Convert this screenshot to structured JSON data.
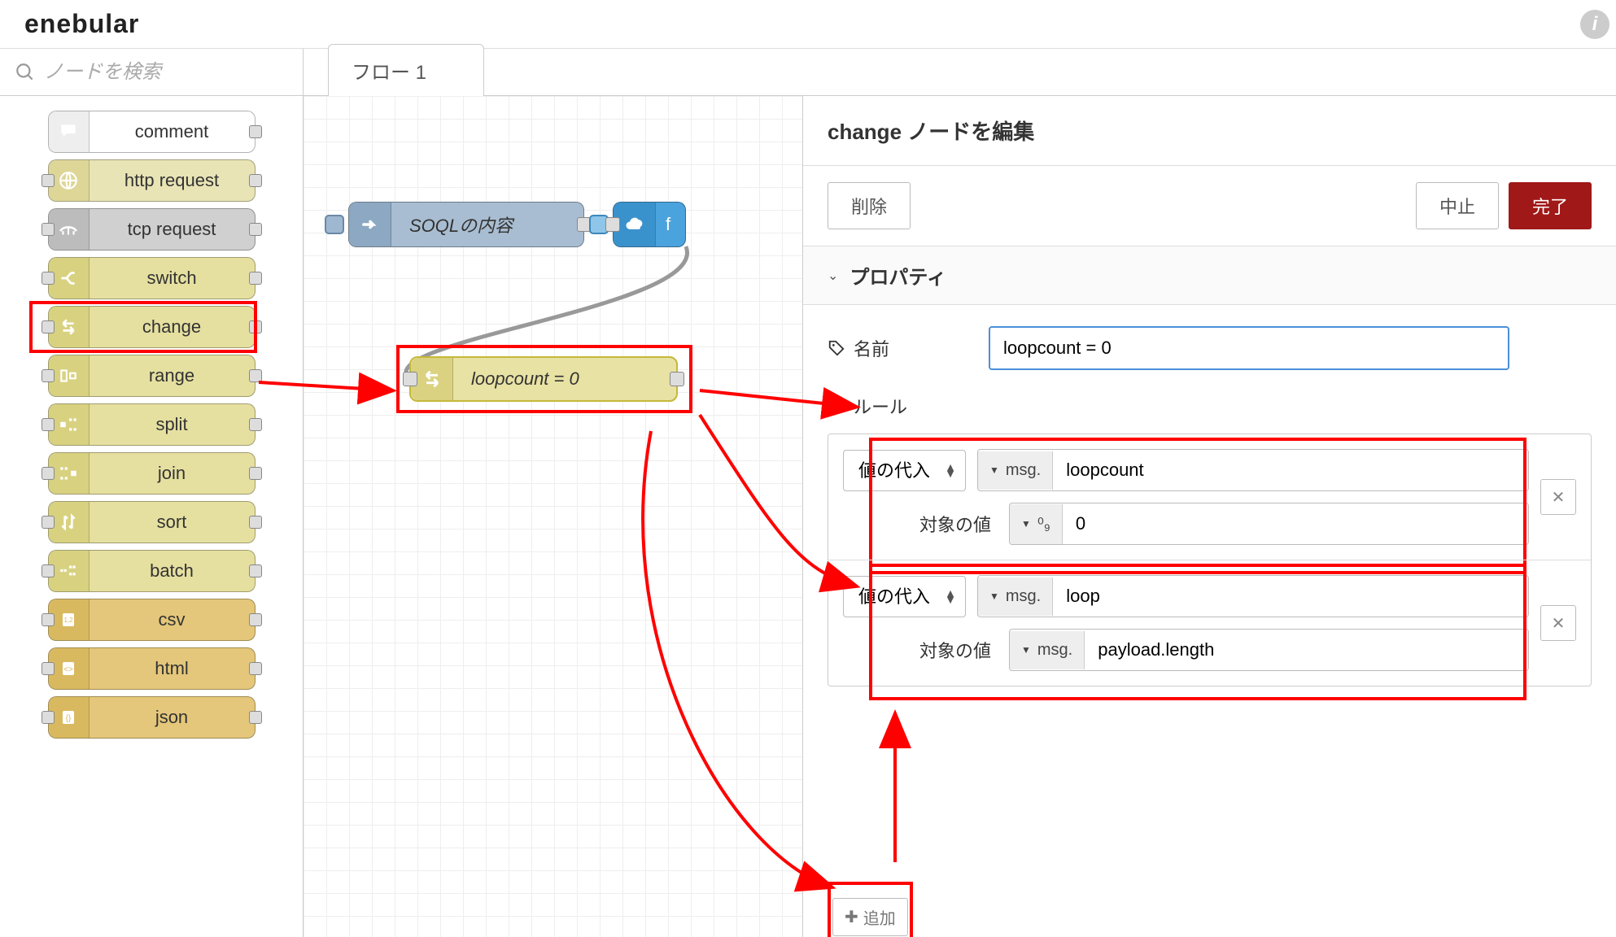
{
  "header": {
    "logo": "enebular"
  },
  "search": {
    "placeholder": "ノードを検索"
  },
  "tab": {
    "label": "フロー 1"
  },
  "palette": {
    "comment": "comment",
    "http_request": "http request",
    "tcp_request": "tcp request",
    "switch": "switch",
    "change": "change",
    "range": "range",
    "split": "split",
    "join": "join",
    "sort": "sort",
    "batch": "batch",
    "csv": "csv",
    "html": "html",
    "json": "json"
  },
  "canvas": {
    "soql_label": "SOQLの内容",
    "sf_label": "f",
    "loop_label": "loopcount = 0"
  },
  "editor": {
    "title": "change ノードを編集",
    "delete": "削除",
    "cancel": "中止",
    "done": "完了",
    "section": "プロパティ",
    "name_label": "名前",
    "name_value": "loopcount = 0",
    "rules_label": "ルール",
    "rule1": {
      "action": "値の代入",
      "prop_prefix": "msg.",
      "prop_value": "loopcount",
      "to_label": "対象の値",
      "to_type": "⁰₉",
      "to_value": "0"
    },
    "rule2": {
      "action": "値の代入",
      "prop_prefix": "msg.",
      "prop_value": "loop",
      "to_label": "対象の値",
      "to_type": "msg.",
      "to_value": "payload.length"
    },
    "add": "追加"
  }
}
